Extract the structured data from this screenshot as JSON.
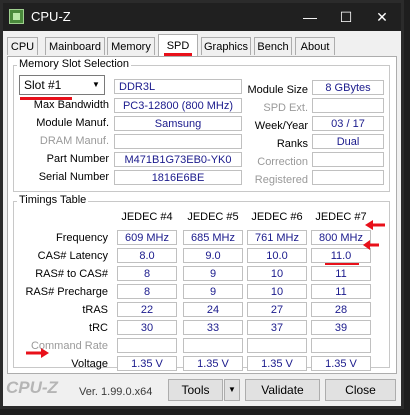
{
  "window": {
    "title": "CPU-Z",
    "minimize": "—",
    "maximize": "☐",
    "close": "✕"
  },
  "tabs": [
    "CPU",
    "Mainboard",
    "Memory",
    "SPD",
    "Graphics",
    "Bench",
    "About"
  ],
  "active_tab": "SPD",
  "slot_group": {
    "title": "Memory Slot Selection",
    "slot": "Slot #1",
    "type": "DDR3L",
    "labels": {
      "max_bandwidth": "Max Bandwidth",
      "module_manuf": "Module Manuf.",
      "dram_manuf": "DRAM Manuf.",
      "part_number": "Part Number",
      "serial_number": "Serial Number",
      "module_size": "Module Size",
      "spd_ext": "SPD Ext.",
      "week_year": "Week/Year",
      "ranks": "Ranks",
      "correction": "Correction",
      "registered": "Registered"
    },
    "values": {
      "max_bandwidth": "PC3-12800 (800 MHz)",
      "module_manuf": "Samsung",
      "dram_manuf": "",
      "part_number": "M471B1G73EB0-YK0",
      "serial_number": "1816E6BE",
      "module_size": "8 GBytes",
      "spd_ext": "",
      "week_year": "03 / 17",
      "ranks": "Dual",
      "correction": "",
      "registered": ""
    }
  },
  "timings": {
    "title": "Timings Table",
    "columns": [
      "JEDEC #4",
      "JEDEC #5",
      "JEDEC #6",
      "JEDEC #7"
    ],
    "rows": [
      {
        "label": "Frequency",
        "values": [
          "609 MHz",
          "685 MHz",
          "761 MHz",
          "800 MHz"
        ]
      },
      {
        "label": "CAS# Latency",
        "values": [
          "8.0",
          "9.0",
          "10.0",
          "11.0"
        ]
      },
      {
        "label": "RAS# to CAS#",
        "values": [
          "8",
          "9",
          "10",
          "11"
        ]
      },
      {
        "label": "RAS# Precharge",
        "values": [
          "8",
          "9",
          "10",
          "11"
        ]
      },
      {
        "label": "tRAS",
        "values": [
          "22",
          "24",
          "27",
          "28"
        ]
      },
      {
        "label": "tRC",
        "values": [
          "30",
          "33",
          "37",
          "39"
        ]
      },
      {
        "label": "Command Rate",
        "values": [
          "",
          "",
          "",
          ""
        ]
      },
      {
        "label": "Voltage",
        "values": [
          "1.35 V",
          "1.35 V",
          "1.35 V",
          "1.35 V"
        ]
      }
    ]
  },
  "footer": {
    "logo": "CPU-Z",
    "version": "Ver. 1.99.0.x64",
    "tools": "Tools",
    "validate": "Validate",
    "close": "Close"
  },
  "annotation_color": "#e8101a"
}
